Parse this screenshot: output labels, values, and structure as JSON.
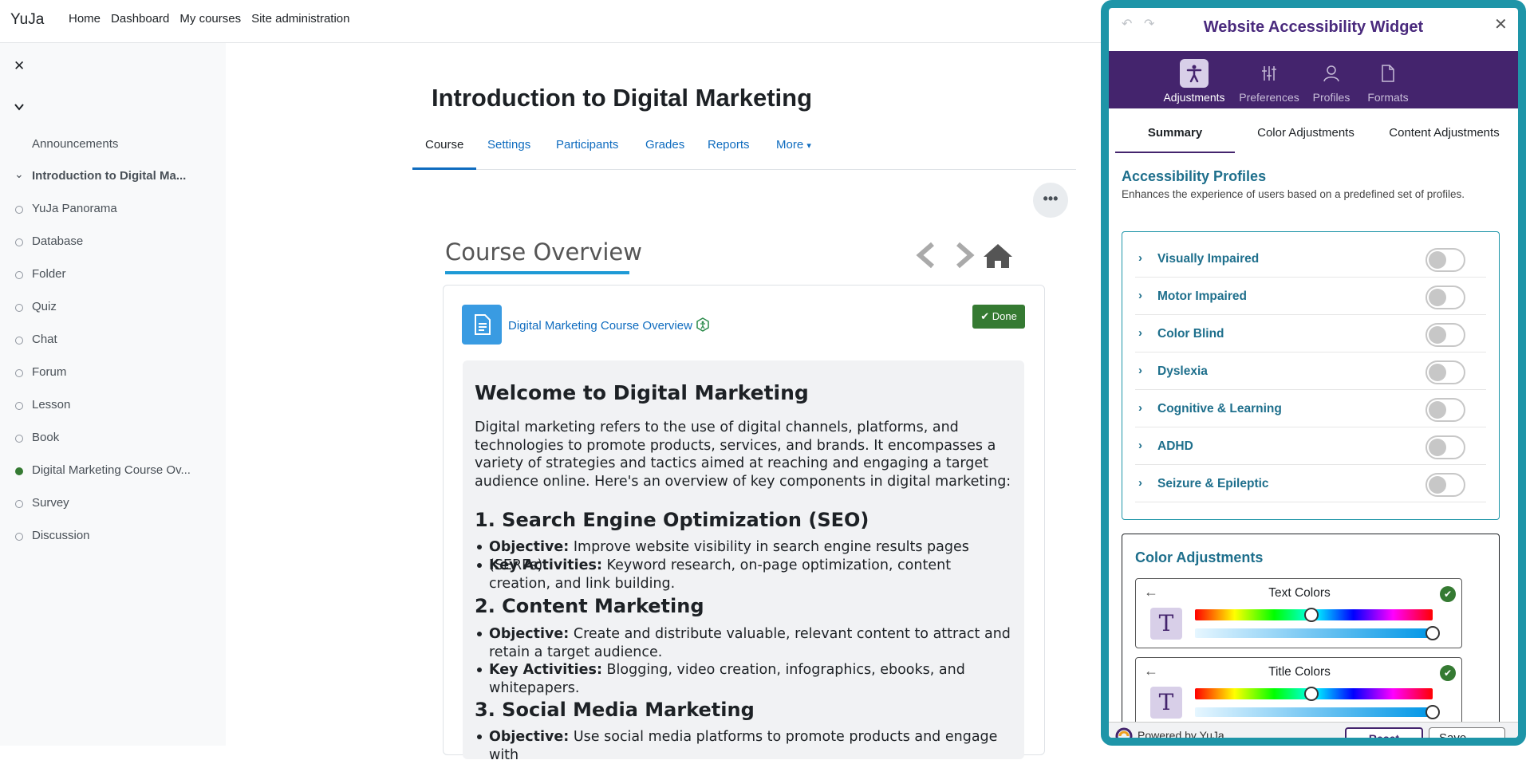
{
  "app": {
    "brand": "YuJa"
  },
  "topnav": [
    "Home",
    "Dashboard",
    "My courses",
    "Site administration"
  ],
  "sidebar": {
    "items": [
      {
        "label": "Announcements",
        "status": "none"
      },
      {
        "label": "Introduction to Digital Ma...",
        "status": "section"
      },
      {
        "label": "YuJa Panorama",
        "status": "incomplete"
      },
      {
        "label": "Database",
        "status": "incomplete"
      },
      {
        "label": "Folder",
        "status": "incomplete"
      },
      {
        "label": "Quiz",
        "status": "incomplete"
      },
      {
        "label": "Chat",
        "status": "incomplete"
      },
      {
        "label": "Forum",
        "status": "incomplete"
      },
      {
        "label": "Lesson",
        "status": "incomplete"
      },
      {
        "label": "Book",
        "status": "incomplete"
      },
      {
        "label": "Digital Marketing Course Ov...",
        "status": "complete"
      },
      {
        "label": "Survey",
        "status": "incomplete"
      },
      {
        "label": "Discussion",
        "status": "incomplete"
      }
    ]
  },
  "course": {
    "title": "Introduction to Digital Marketing",
    "tabs": [
      "Course",
      "Settings",
      "Participants",
      "Grades",
      "Reports",
      "More"
    ],
    "active_tab": "Course"
  },
  "overview": {
    "title": "Course Overview",
    "activity_link": "Digital Marketing Course Overview",
    "done_label": "Done",
    "content": {
      "h1": "Welcome to Digital Marketing",
      "intro": "Digital marketing refers to the use of digital channels, platforms, and technologies to promote products, services, and brands. It encompasses a variety of strategies and tactics aimed at reaching and engaging a target audience online. Here's an overview of key components in digital marketing:",
      "sections": [
        {
          "heading": "1. Search Engine Optimization (SEO)",
          "items": [
            {
              "label": "Objective:",
              "text": " Improve website visibility in search engine results pages (SERPs)."
            },
            {
              "label": "Key Activities:",
              "text": " Keyword research, on-page optimization, content creation, and link building."
            }
          ]
        },
        {
          "heading": "2. Content Marketing",
          "items": [
            {
              "label": "Objective:",
              "text": " Create and distribute valuable, relevant content to attract and retain a target audience."
            },
            {
              "label": "Key Activities:",
              "text": " Blogging, video creation, infographics, ebooks, and whitepapers."
            }
          ]
        },
        {
          "heading": "3. Social Media Marketing",
          "items": [
            {
              "label": "Objective:",
              "text": " Use social media platforms to promote products and engage with"
            }
          ]
        }
      ]
    }
  },
  "widget": {
    "title": "Website Accessibility Widget",
    "nav": [
      "Adjustments",
      "Preferences",
      "Profiles",
      "Formats"
    ],
    "active_nav": "Adjustments",
    "tabs": [
      "Summary",
      "Color Adjustments",
      "Content Adjustments"
    ],
    "active_tab": "Summary",
    "profiles_title": "Accessibility Profiles",
    "profiles_desc": "Enhances the experience of users based on a predefined set of profiles.",
    "profiles": [
      {
        "label": "Visually Impaired",
        "enabled": false
      },
      {
        "label": "Motor Impaired",
        "enabled": false
      },
      {
        "label": "Color Blind",
        "enabled": false
      },
      {
        "label": "Dyslexia",
        "enabled": false
      },
      {
        "label": "Cognitive & Learning",
        "enabled": false
      },
      {
        "label": "ADHD",
        "enabled": false
      },
      {
        "label": "Seizure & Epileptic",
        "enabled": false
      }
    ],
    "color_adjustments_title": "Color Adjustments",
    "color_boxes": [
      {
        "label": "Text Colors",
        "hue": 0.49,
        "lightness": 1.0
      },
      {
        "label": "Title Colors",
        "hue": 0.49,
        "lightness": 1.0
      }
    ],
    "footer": {
      "powered_by": "Powered by YuJa",
      "reset": "Reset",
      "save": "Save"
    }
  },
  "colors": {
    "link": "#0f6cbf",
    "widget_purple": "#44246d",
    "widget_teal": "#1e95a8",
    "done_green": "#357a32"
  }
}
